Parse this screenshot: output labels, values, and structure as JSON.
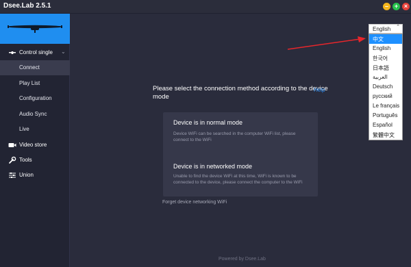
{
  "app": {
    "title": "Dsee.Lab 2.5.1"
  },
  "window_buttons": {
    "minimize": "–",
    "maximize": "+",
    "close": "×"
  },
  "sidebar": {
    "group": "Control single",
    "sub_items": [
      "Connect",
      "Play List",
      "Configuration",
      "Audio Sync",
      "Live"
    ],
    "active": "Connect",
    "items": [
      {
        "label": "Video store",
        "icon": "video-icon"
      },
      {
        "label": "Tools",
        "icon": "wrench-icon"
      },
      {
        "label": "Union",
        "icon": "sliders-icon"
      }
    ]
  },
  "main": {
    "prompt": "Please select the connection method according to the device mode",
    "help": "Help",
    "cards": [
      {
        "title": "Device is in normal mode",
        "desc": "Device WiFi can be searched in the computer WiFi list, please connect to the WiFi"
      },
      {
        "title": "Device is in networked mode",
        "desc": "Unable to find the device WiFi at this time, WiFi is known to be connected to the device, please connect the computer to the WiFi"
      }
    ],
    "forget": "Forget device networking WiFi",
    "footer": "Powered by Dsee.Lab"
  },
  "language": {
    "current": "English",
    "options": [
      "中文",
      "English",
      "한국어",
      "日本語",
      "العربية",
      "Deutsch",
      "русский",
      "Le français",
      "Português",
      "Español",
      "繁體中文"
    ],
    "highlighted": "中文"
  },
  "colors": {
    "accent": "#1e90ff",
    "banner": "#1f8ef0",
    "background": "#2a2c3c",
    "sidebar": "#222433",
    "arrow": "#e8262b"
  }
}
